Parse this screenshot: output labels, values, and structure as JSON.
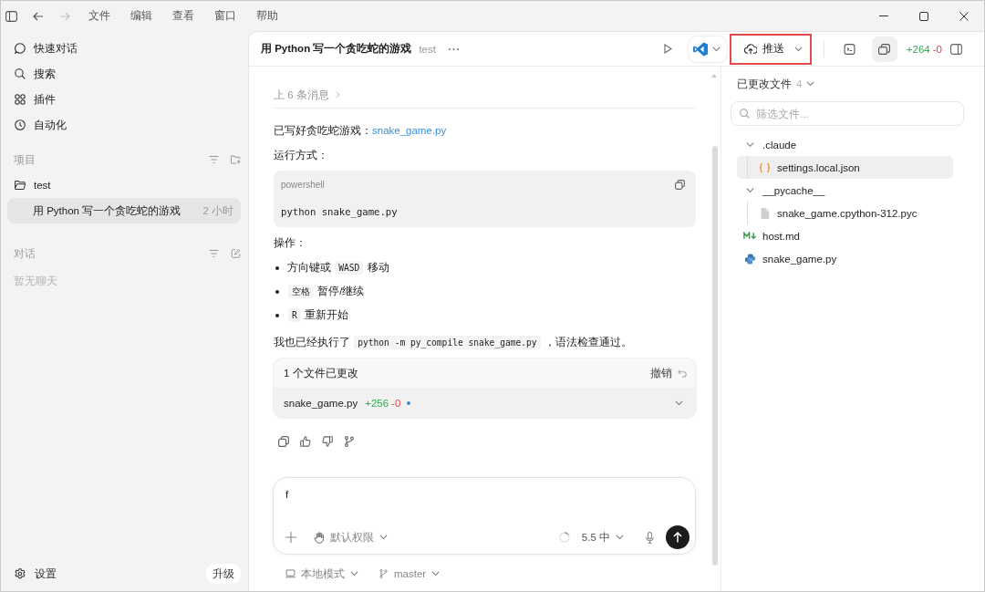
{
  "titlebar": {
    "nav": [
      {
        "kind": "back",
        "disabled": false
      },
      {
        "kind": "forward",
        "disabled": true
      }
    ],
    "menus": [
      "文件",
      "编辑",
      "查看",
      "窗口",
      "帮助"
    ]
  },
  "sidebar": {
    "nav": [
      {
        "kind": "quick-chat",
        "label": "快速对话"
      },
      {
        "kind": "search",
        "label": "搜索"
      },
      {
        "kind": "plugins",
        "label": "插件"
      },
      {
        "kind": "automation",
        "label": "自动化"
      }
    ],
    "projects": {
      "heading": "项目",
      "folders": [
        {
          "name": "test",
          "threads": [
            {
              "title": "用 Python 写一个贪吃蛇的游戏",
              "time": "2 小时",
              "selected": true
            }
          ]
        }
      ]
    },
    "chats": {
      "heading": "对话",
      "empty_text": "暂无聊天"
    },
    "footer": {
      "settings_label": "设置",
      "upgrade_label": "升级"
    }
  },
  "header": {
    "title": "用 Python 写一个贪吃蛇的游戏",
    "project": "test",
    "push_button": {
      "label": "推送",
      "highlighted": true
    },
    "toggles": [
      {
        "kind": "terminal",
        "selected": false
      },
      {
        "kind": "panels",
        "selected": true
      }
    ],
    "diff": {
      "added": "+264",
      "removed": "-0"
    }
  },
  "chat": {
    "earlier_messages": "上 6 条消息",
    "blocks": [
      {
        "kind": "paragraph",
        "parts": [
          {
            "kind": "text",
            "text": "已写好贪吃蛇游戏："
          },
          {
            "kind": "link",
            "text": "snake_game.py"
          }
        ]
      },
      {
        "kind": "paragraph",
        "parts": [
          {
            "kind": "text",
            "text": "运行方式："
          }
        ]
      },
      {
        "kind": "code",
        "language": "powershell",
        "code": "python snake_game.py"
      },
      {
        "kind": "paragraph",
        "parts": [
          {
            "kind": "text",
            "text": "操作："
          }
        ]
      },
      {
        "kind": "list",
        "items": [
          {
            "parts": [
              {
                "kind": "text",
                "text": "方向键或 "
              },
              {
                "kind": "code",
                "text": "WASD"
              },
              {
                "kind": "text",
                "text": " 移动"
              }
            ]
          },
          {
            "parts": [
              {
                "kind": "code",
                "text": "空格"
              },
              {
                "kind": "text",
                "text": " 暂停/继续"
              }
            ]
          },
          {
            "parts": [
              {
                "kind": "code",
                "text": "R"
              },
              {
                "kind": "text",
                "text": " 重新开始"
              }
            ]
          }
        ]
      },
      {
        "kind": "paragraph",
        "parts": [
          {
            "kind": "text",
            "text": "我也已经执行了 "
          },
          {
            "kind": "code",
            "text": "python -m py_compile snake_game.py"
          },
          {
            "kind": "text",
            "text": " ，语法检查通过。"
          }
        ]
      }
    ],
    "changes": {
      "summary": "1 个文件已更改",
      "undo_label": "撤销",
      "files": [
        {
          "name": "snake_game.py",
          "added": "+256",
          "removed": "-0",
          "status_dot": true
        }
      ]
    }
  },
  "composer": {
    "value": "f",
    "permission": "默认权限",
    "model": "5.5 中"
  },
  "environment": {
    "mode": "本地模式",
    "branch": "master"
  },
  "changed_files": {
    "title": "已更改文件",
    "count": "4",
    "filter": {
      "placeholder": "筛选文件..."
    },
    "tree": [
      {
        "kind": "folder",
        "name": ".claude",
        "expanded": true,
        "selected": false,
        "children": [
          {
            "kind": "json",
            "name": "settings.local.json",
            "selected": true
          }
        ]
      },
      {
        "kind": "folder",
        "name": "__pycache__",
        "expanded": true,
        "selected": false,
        "children": [
          {
            "kind": "binary",
            "name": "snake_game.cpython-312.pyc",
            "selected": false
          }
        ]
      },
      {
        "kind": "markdown",
        "name": "host.md",
        "selected": false
      },
      {
        "kind": "python",
        "name": "snake_game.py",
        "selected": false
      }
    ]
  }
}
